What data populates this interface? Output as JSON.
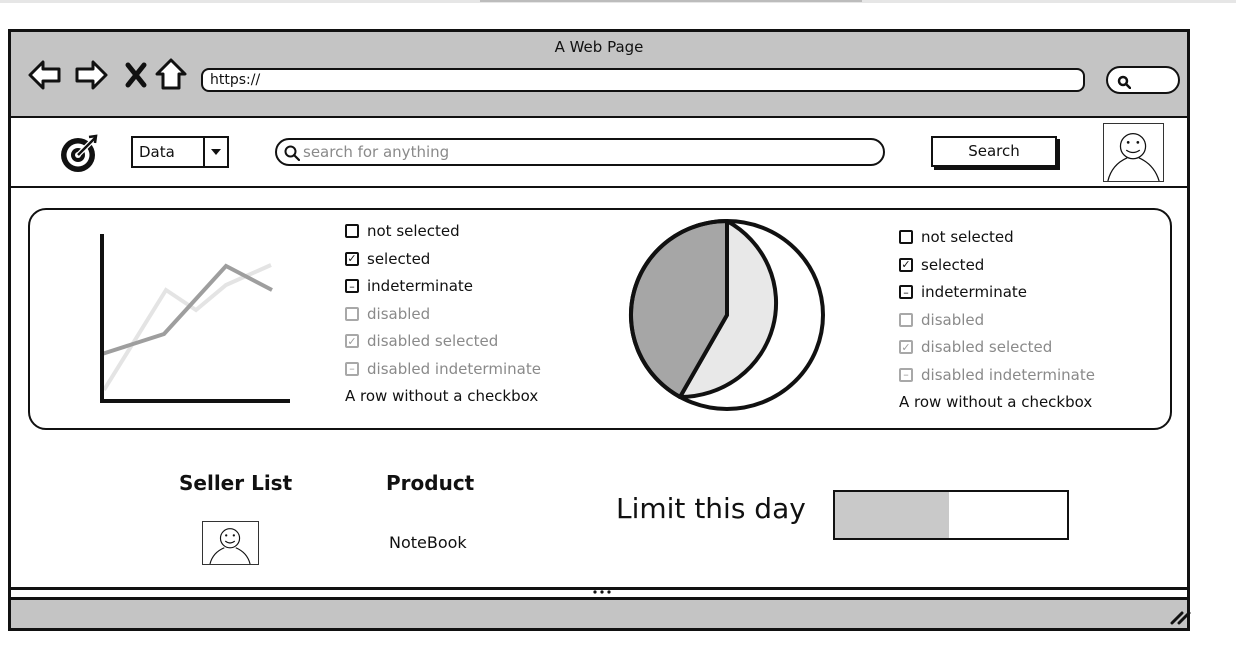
{
  "browser": {
    "window_title": "A Web Page",
    "url": "https://"
  },
  "header": {
    "dropdown_value": "Data",
    "search_placeholder": "search for anything",
    "search_button": "Search"
  },
  "left_checkbox_list": [
    {
      "label": "not selected",
      "state": "unchecked",
      "disabled": false
    },
    {
      "label": "selected",
      "state": "checked",
      "disabled": false
    },
    {
      "label": "indeterminate",
      "state": "indeterminate",
      "disabled": false
    },
    {
      "label": "disabled",
      "state": "unchecked",
      "disabled": true
    },
    {
      "label": "disabled selected",
      "state": "checked",
      "disabled": true
    },
    {
      "label": "disabled indeterminate",
      "state": "indeterminate",
      "disabled": true
    },
    {
      "label": "A row without a checkbox",
      "state": "none",
      "disabled": false
    }
  ],
  "right_checkbox_list": [
    {
      "label": "not selected",
      "state": "unchecked",
      "disabled": false
    },
    {
      "label": "selected",
      "state": "checked",
      "disabled": false
    },
    {
      "label": "indeterminate",
      "state": "indeterminate",
      "disabled": false
    },
    {
      "label": "disabled",
      "state": "unchecked",
      "disabled": true
    },
    {
      "label": "disabled selected",
      "state": "checked",
      "disabled": true
    },
    {
      "label": "disabled indeterminate",
      "state": "indeterminate",
      "disabled": true
    },
    {
      "label": "A row without a checkbox",
      "state": "none",
      "disabled": false
    }
  ],
  "seller_list": {
    "title": "Seller List"
  },
  "product": {
    "title": "Product",
    "item": "NoteBook"
  },
  "limit": {
    "label": "Limit this day",
    "progress_fraction": 0.49
  },
  "colors": {
    "chrome_gray": "#c4c4c4",
    "pie_dark": "#a6a6a6",
    "pie_light": "#e8e8e8",
    "line_dark": "#9e9e9e",
    "line_light": "#e4e4e4",
    "disabled_text": "#8a8a8a"
  },
  "icons": {
    "back": "arrow-left-icon",
    "forward": "arrow-right-icon",
    "stop": "close-icon",
    "home": "home-icon",
    "search": "search-icon",
    "logo": "target-logo-icon",
    "resize": "resize-grip-icon"
  }
}
